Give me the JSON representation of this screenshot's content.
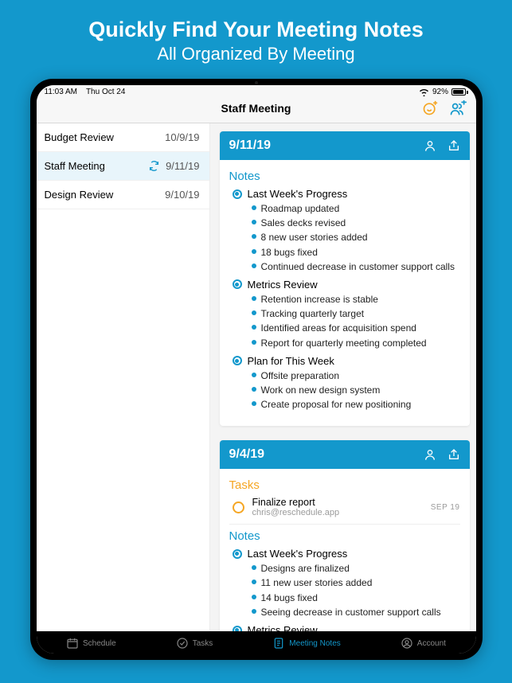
{
  "promo": {
    "headline": "Quickly Find Your Meeting Notes",
    "subline": "All Organized By Meeting"
  },
  "statusbar": {
    "time": "11:03 AM",
    "date": "Thu Oct 24",
    "battery": "92%"
  },
  "header": {
    "title": "Staff Meeting"
  },
  "meetings": [
    {
      "name": "Budget Review",
      "date": "10/9/19",
      "selected": false,
      "syncing": false
    },
    {
      "name": "Staff Meeting",
      "date": "9/11/19",
      "selected": true,
      "syncing": true
    },
    {
      "name": "Design Review",
      "date": "9/10/19",
      "selected": false,
      "syncing": false
    }
  ],
  "cards": [
    {
      "date": "9/11/19",
      "notes_label": "Notes",
      "sections": [
        {
          "title": "Last Week's Progress",
          "items": [
            "Roadmap updated",
            "Sales decks revised",
            "8 new user stories added",
            "18 bugs fixed",
            "Continued decrease in customer support calls"
          ]
        },
        {
          "title": "Metrics Review",
          "items": [
            "Retention increase is stable",
            "Tracking quarterly target",
            "Identified areas for acquisition spend",
            "Report for quarterly meeting completed"
          ]
        },
        {
          "title": "Plan for This Week",
          "items": [
            "Offsite preparation",
            "Work on new design system",
            "Create proposal for new positioning"
          ]
        }
      ]
    },
    {
      "date": "9/4/19",
      "tasks_label": "Tasks",
      "tasks": [
        {
          "title": "Finalize report",
          "subtitle": "chris@reschedule.app",
          "due": "SEP 19"
        }
      ],
      "notes_label": "Notes",
      "sections": [
        {
          "title": "Last Week's Progress",
          "items": [
            "Designs are finalized",
            "11 new user stories added",
            "14 bugs fixed",
            "Seeing decrease in customer support calls"
          ]
        },
        {
          "title": "Metrics Review",
          "items": []
        }
      ]
    }
  ],
  "tabs": {
    "schedule": "Schedule",
    "tasks": "Tasks",
    "notes": "Meeting Notes",
    "account": "Account"
  }
}
